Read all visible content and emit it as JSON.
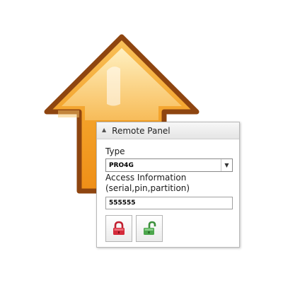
{
  "panel": {
    "title": "Remote Panel",
    "collapse_icon": "chevron-up-icon"
  },
  "type_field": {
    "label": "Type",
    "selected_value": "PRO4G",
    "dropdown_icon": "chevron-down-icon"
  },
  "access_field": {
    "label_line1": "Access Information",
    "label_line2": "(serial,pin,partition)",
    "value": "555555"
  },
  "buttons": {
    "lock": {
      "icon": "lock-icon",
      "color": "#d42a3a"
    },
    "unlock": {
      "icon": "unlock-icon",
      "color": "#4ca64c"
    }
  },
  "background_art": {
    "icon": "up-arrow-icon",
    "fill_color": "#f5a623",
    "outline_color": "#9a4a10"
  }
}
